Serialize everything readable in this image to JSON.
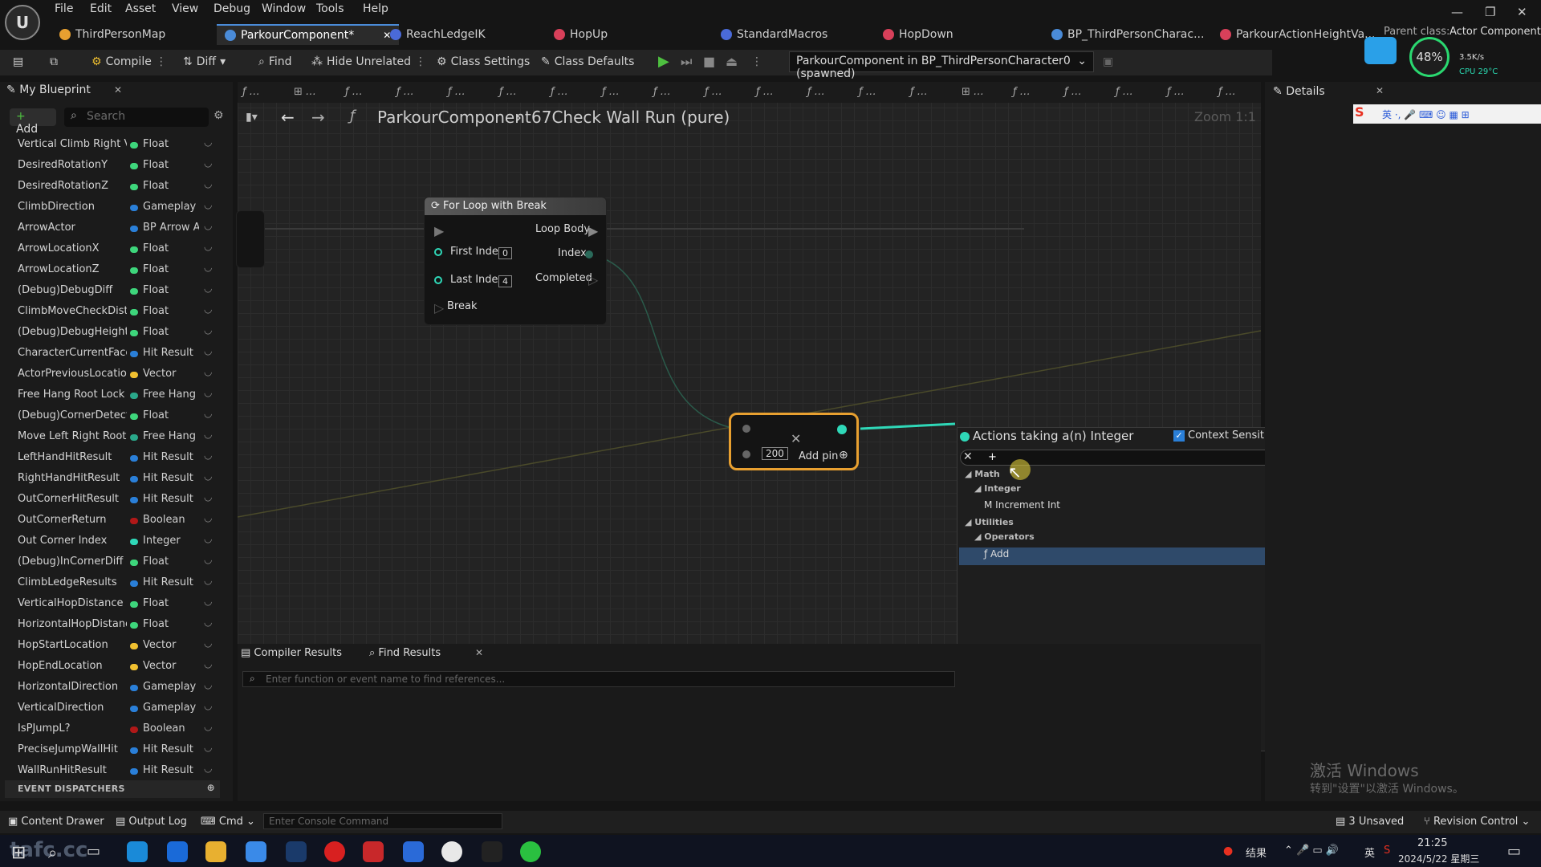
{
  "menu": [
    "File",
    "Edit",
    "Asset",
    "View",
    "Debug",
    "Window",
    "Tools",
    "Help"
  ],
  "doc_tabs": [
    {
      "label": "ThirdPersonMap",
      "color": "#e8a030",
      "active": false
    },
    {
      "label": "ParkourComponent*",
      "color": "#4a8bd8",
      "active": true
    },
    {
      "label": "ReachLedgeIK",
      "color": "#4a6ad8",
      "active": false
    },
    {
      "label": "HopUp",
      "color": "#d8405a",
      "active": false
    },
    {
      "label": "StandardMacros",
      "color": "#4a6ad8",
      "active": false
    },
    {
      "label": "HopDown",
      "color": "#d8405a",
      "active": false
    },
    {
      "label": "BP_ThirdPersonCharac...",
      "color": "#4a8bd8",
      "active": false
    },
    {
      "label": "ParkourActionHeightVa...",
      "color": "#d8405a",
      "active": false
    }
  ],
  "parent_class_label": "Parent class:",
  "parent_class_value": "Actor Component",
  "perf": {
    "percent": "48%",
    "net": "3.5K/s",
    "cpu": "CPU 29°C"
  },
  "toolbar": {
    "compile": "Compile",
    "diff": "Diff",
    "find": "Find",
    "hide_unrelated": "Hide Unrelated",
    "class_settings": "Class Settings",
    "class_defaults": "Class Defaults",
    "debug_object": "ParkourComponent in BP_ThirdPersonCharacter0 (spawned)"
  },
  "left_panel": {
    "tab": "My Blueprint",
    "add": "Add",
    "search_placeholder": "Search",
    "variables": [
      {
        "name": "Vertical Climb Right Val",
        "type": "Float",
        "color": "#3ed67c"
      },
      {
        "name": "DesiredRotationY",
        "type": "Float",
        "color": "#3ed67c"
      },
      {
        "name": "DesiredRotationZ",
        "type": "Float",
        "color": "#3ed67c"
      },
      {
        "name": "ClimbDirection",
        "type": "Gameplay T",
        "color": "#2a7fd8"
      },
      {
        "name": "ArrowActor",
        "type": "BP Arrow A",
        "color": "#2a7fd8"
      },
      {
        "name": "ArrowLocationX",
        "type": "Float",
        "color": "#3ed67c"
      },
      {
        "name": "ArrowLocationZ",
        "type": "Float",
        "color": "#3ed67c"
      },
      {
        "name": "(Debug)DebugDiff",
        "type": "Float",
        "color": "#3ed67c"
      },
      {
        "name": "ClimbMoveCheckDistai",
        "type": "Float",
        "color": "#3ed67c"
      },
      {
        "name": "(Debug)DebugHeightDi",
        "type": "Float",
        "color": "#3ed67c"
      },
      {
        "name": "CharacterCurrentFaceW",
        "type": "Hit Result",
        "color": "#2a7fd8"
      },
      {
        "name": "ActorPreviousLocation",
        "type": "Vector",
        "color": "#f0c030"
      },
      {
        "name": "Free Hang Root Lock",
        "type": "Free Hang E",
        "color": "#2aa88a"
      },
      {
        "name": "(Debug)CornerDetectZ",
        "type": "Float",
        "color": "#3ed67c"
      },
      {
        "name": "Move Left Right Root Lc",
        "type": "Free Hang M",
        "color": "#2aa88a"
      },
      {
        "name": "LeftHandHitResult",
        "type": "Hit Result",
        "color": "#2a7fd8"
      },
      {
        "name": "RightHandHitResult",
        "type": "Hit Result",
        "color": "#2a7fd8"
      },
      {
        "name": "OutCornerHitResult",
        "type": "Hit Result",
        "color": "#2a7fd8"
      },
      {
        "name": "OutCornerReturn",
        "type": "Boolean",
        "color": "#b01818"
      },
      {
        "name": "Out Corner Index",
        "type": "Integer",
        "color": "#2fd8b8"
      },
      {
        "name": "(Debug)InCornerDiff",
        "type": "Float",
        "color": "#3ed67c"
      },
      {
        "name": "ClimbLedgeResults",
        "type": "Hit Result",
        "color": "#2a7fd8"
      },
      {
        "name": "VerticalHopDistance",
        "type": "Float",
        "color": "#3ed67c"
      },
      {
        "name": "HorizontalHopDistance",
        "type": "Float",
        "color": "#3ed67c"
      },
      {
        "name": "HopStartLocation",
        "type": "Vector",
        "color": "#f0c030"
      },
      {
        "name": "HopEndLocation",
        "type": "Vector",
        "color": "#f0c030"
      },
      {
        "name": "HorizontalDirection",
        "type": "Gameplay T",
        "color": "#2a7fd8"
      },
      {
        "name": "VerticalDirection",
        "type": "Gameplay T",
        "color": "#2a7fd8"
      },
      {
        "name": "IsPJumpL?",
        "type": "Boolean",
        "color": "#b01818"
      },
      {
        "name": "PreciseJumpWallHit",
        "type": "Hit Result",
        "color": "#2a7fd8"
      },
      {
        "name": "WallRunHitResult",
        "type": "Hit Result",
        "color": "#2a7fd8"
      }
    ],
    "section": "EVENT DISPATCHERS"
  },
  "graph": {
    "breadcrumb_root": "ParkourComponent",
    "breadcrumb_fn": "67Check Wall Run (pure)",
    "zoom": "Zoom 1:1",
    "for_loop": {
      "title": "For Loop with Break",
      "loop_body": "Loop Body",
      "first_index": "First Index",
      "first_val": "0",
      "last_index": "Last Index",
      "last_val": "4",
      "index": "Index",
      "completed": "Completed",
      "break": "Break"
    },
    "add_node": {
      "value": "200",
      "add_pin": "Add pin"
    }
  },
  "action_menu": {
    "title": "Actions taking a(n) Integer",
    "context_sensitive": "Context Sensitive",
    "filter": "+",
    "items": [
      {
        "label": "Math",
        "level": 0
      },
      {
        "label": "Integer",
        "level": 1
      },
      {
        "label": "Increment Int",
        "level": 2
      },
      {
        "label": "Utilities",
        "level": 0
      },
      {
        "label": "Operators",
        "level": 1
      },
      {
        "label": "Add",
        "level": 2
      }
    ]
  },
  "bottom": {
    "compiler_results": "Compiler Results",
    "find_results": "Find Results",
    "find_placeholder": "Enter function or event name to find references..."
  },
  "details": {
    "tab": "Details"
  },
  "watermark": {
    "line1": "激活 Windows",
    "line2": "转到\"设置\"以激活 Windows。"
  },
  "status": {
    "content_drawer": "Content Drawer",
    "output_log": "Output Log",
    "cmd": "Cmd",
    "console_placeholder": "Enter Console Command",
    "unsaved": "3 Unsaved",
    "revision": "Revision Control"
  },
  "taskbar": {
    "time": "21:25",
    "date": "2024/5/22 星期三",
    "ime_a": "结果",
    "ime_b": "英",
    "overlay": "tafc.cc"
  }
}
